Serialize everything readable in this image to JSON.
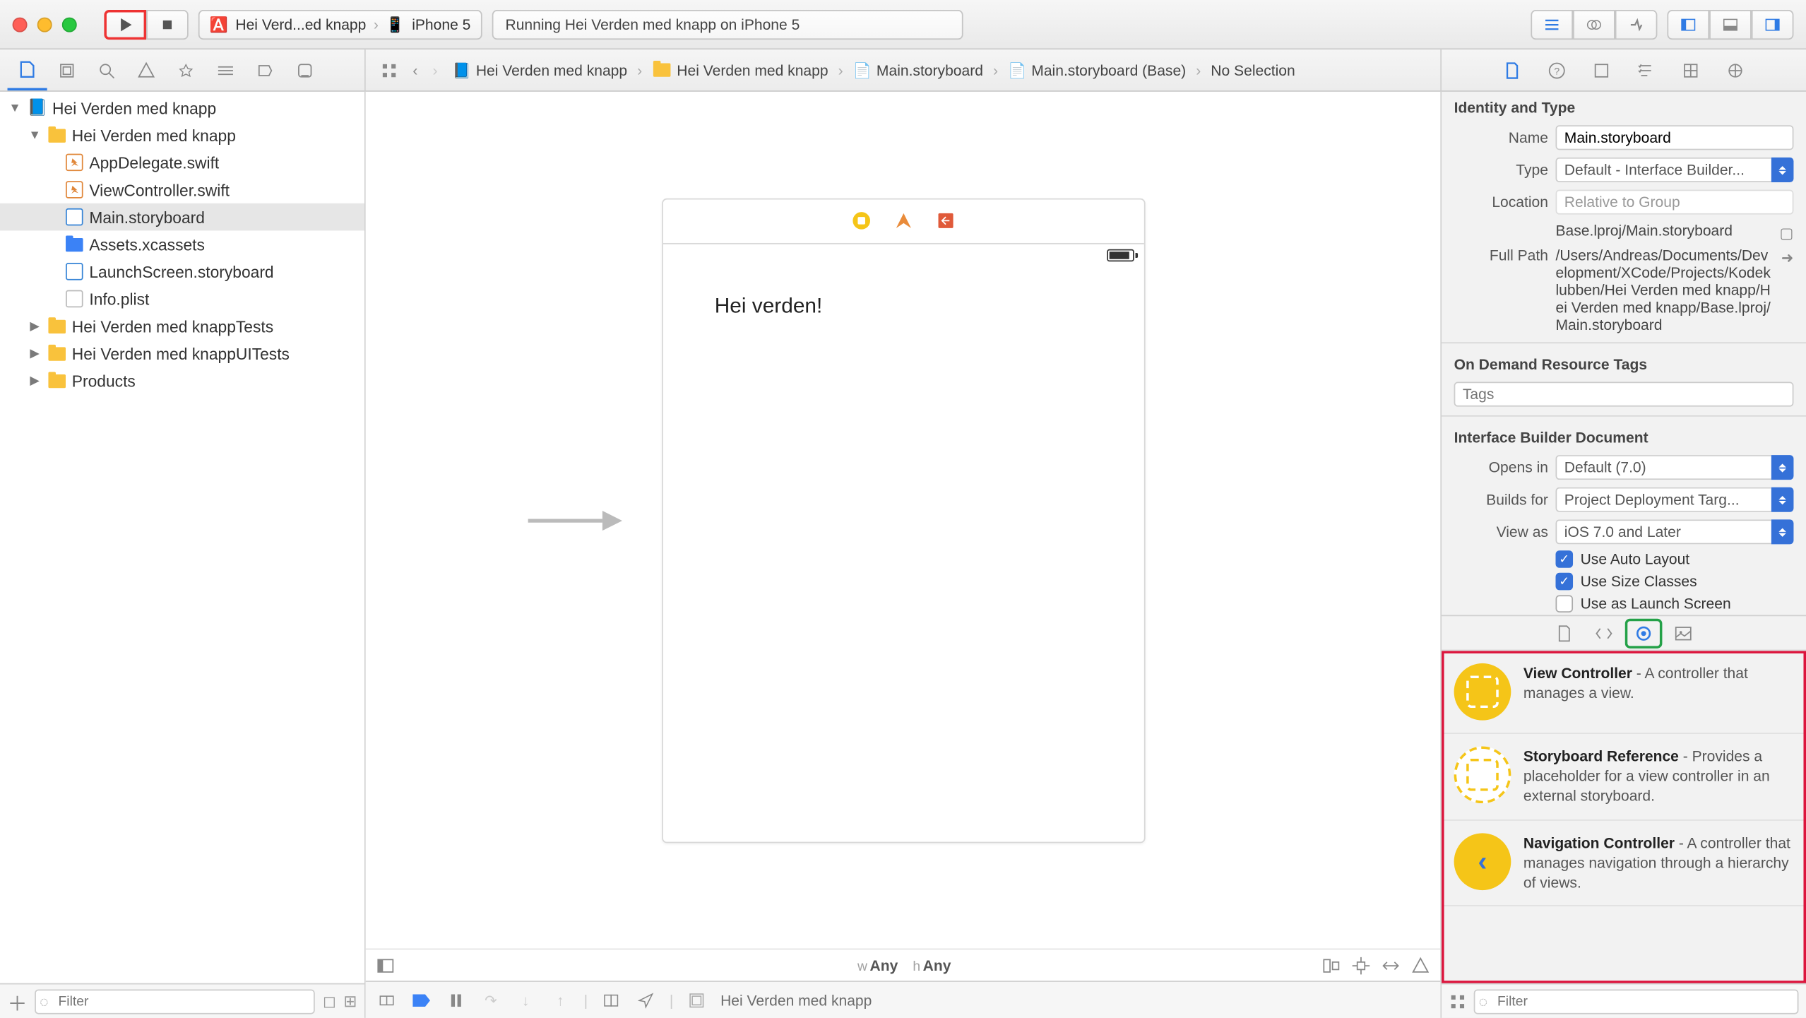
{
  "toolbar": {
    "scheme_project": "Hei Verd...ed knapp",
    "scheme_device": "iPhone 5",
    "status_text": "Running Hei Verden med knapp on iPhone 5"
  },
  "navigator": {
    "root": "Hei Verden med knapp",
    "group": "Hei Verden med knapp",
    "files": {
      "appdelegate": "AppDelegate.swift",
      "viewcontroller": "ViewController.swift",
      "mainstoryboard": "Main.storyboard",
      "assets": "Assets.xcassets",
      "launchscreen": "LaunchScreen.storyboard",
      "infoplist": "Info.plist"
    },
    "tests_group": "Hei Verden med knappTests",
    "uitests_group": "Hei Verden med knappUITests",
    "products_group": "Products",
    "filter_placeholder": "Filter"
  },
  "jumpbar": {
    "s0": "Hei Verden med knapp",
    "s1": "Hei Verden med knapp",
    "s2": "Main.storyboard",
    "s3": "Main.storyboard (Base)",
    "s4": "No Selection"
  },
  "canvas": {
    "label_text": "Hei verden!",
    "sizeclass_w_prefix": "w",
    "sizeclass_w": "Any",
    "sizeclass_h_prefix": "h",
    "sizeclass_h": "Any",
    "debug_process": "Hei Verden med knapp"
  },
  "inspector": {
    "sec_identity": "Identity and Type",
    "name_label": "Name",
    "name_value": "Main.storyboard",
    "type_label": "Type",
    "type_value": "Default - Interface Builder...",
    "location_label": "Location",
    "location_value": "Relative to Group",
    "location_path": "Base.lproj/Main.storyboard",
    "fullpath_label": "Full Path",
    "fullpath_value": "/Users/Andreas/Documents/Development/XCode/Projects/Kodeklubben/Hei Verden med knapp/Hei Verden med knapp/Base.lproj/Main.storyboard",
    "sec_odr": "On Demand Resource Tags",
    "tags_placeholder": "Tags",
    "sec_ibd": "Interface Builder Document",
    "opensin_label": "Opens in",
    "opensin_value": "Default (7.0)",
    "buildsfor_label": "Builds for",
    "buildsfor_value": "Project Deployment Targ...",
    "viewas_label": "View as",
    "viewas_value": "iOS 7.0 and Later",
    "cb_autolayout": "Use Auto Layout",
    "cb_sizeclasses": "Use Size Classes",
    "cb_launchscreen": "Use as Launch Screen"
  },
  "library": {
    "items": [
      {
        "title": "View Controller",
        "desc": " - A controller that manages a view."
      },
      {
        "title": "Storyboard Reference",
        "desc": " - Provides a placeholder for a view controller in an external storyboard."
      },
      {
        "title": "Navigation Controller",
        "desc": " - A controller that manages navigation through a hierarchy of views."
      }
    ],
    "filter_placeholder": "Filter"
  }
}
